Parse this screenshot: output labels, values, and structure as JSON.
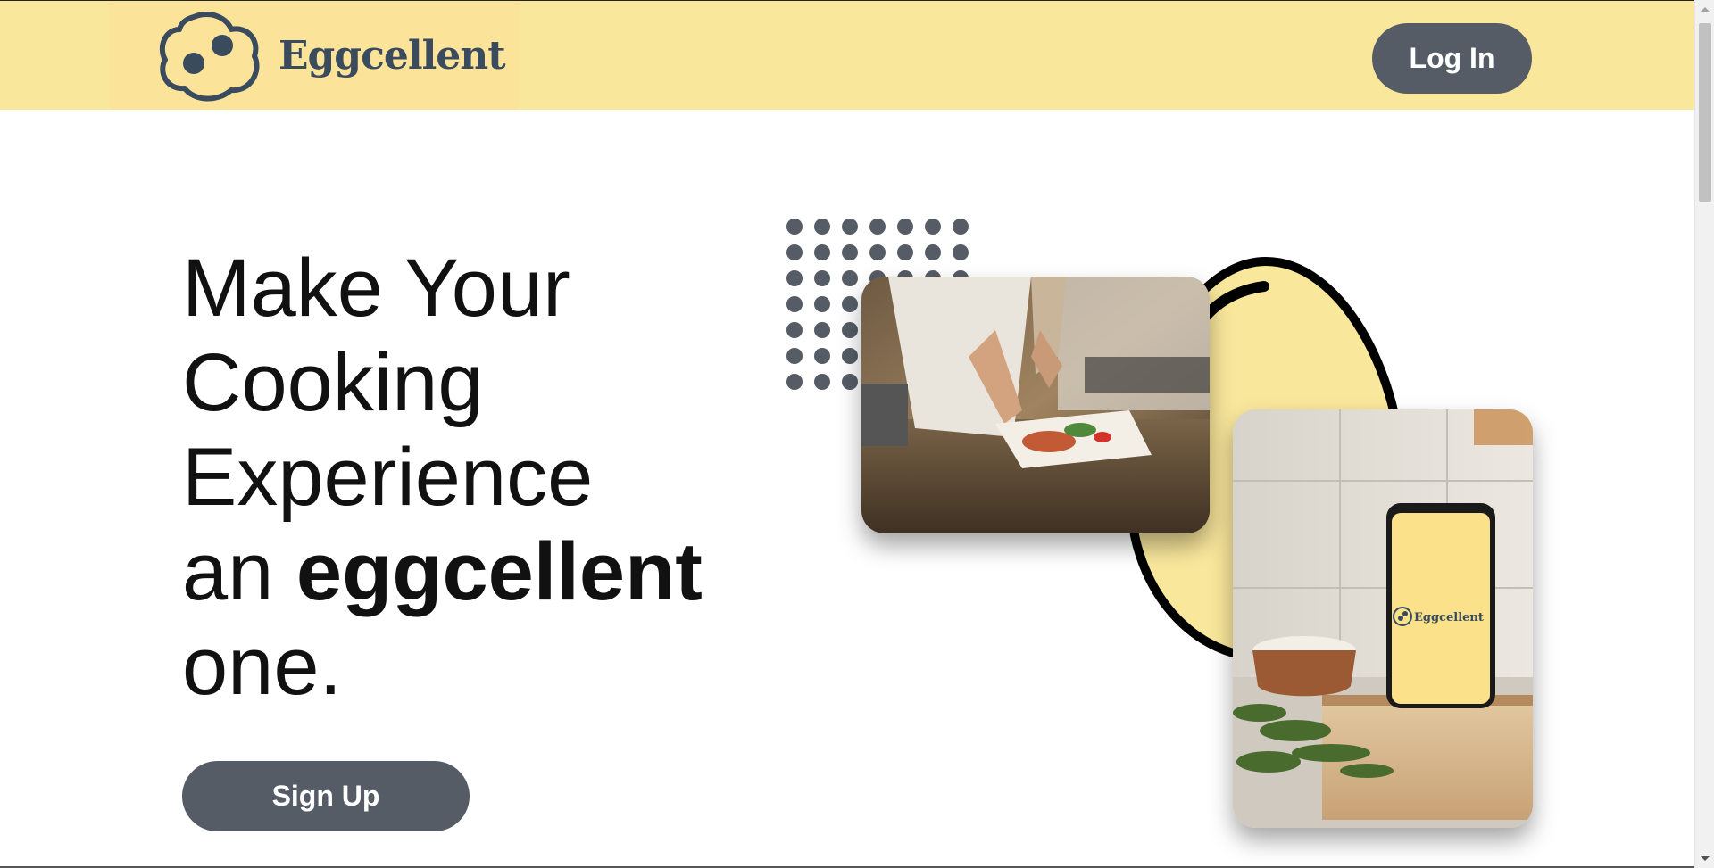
{
  "header": {
    "brand": "Eggcellent",
    "login_label": "Log In"
  },
  "hero": {
    "line1": "Make Your",
    "line2": "Cooking",
    "line3": "Experience",
    "line4_prefix": "an ",
    "line4_bold": "eggcellent",
    "line5": "one.",
    "signup_label": "Sign Up"
  },
  "phone_screen": {
    "brand": "Eggcellent"
  },
  "icons": {
    "logo": "fried-egg-logo-icon",
    "decoration_dots": "dot-grid-decoration",
    "decoration_egg": "egg-outline-decoration"
  },
  "colors": {
    "header_bg": "#f9e79c",
    "button_bg": "#565c66",
    "brand_text": "#3a4b5e",
    "egg_fill": "#f9e79c",
    "dot_color": "#565c66"
  }
}
